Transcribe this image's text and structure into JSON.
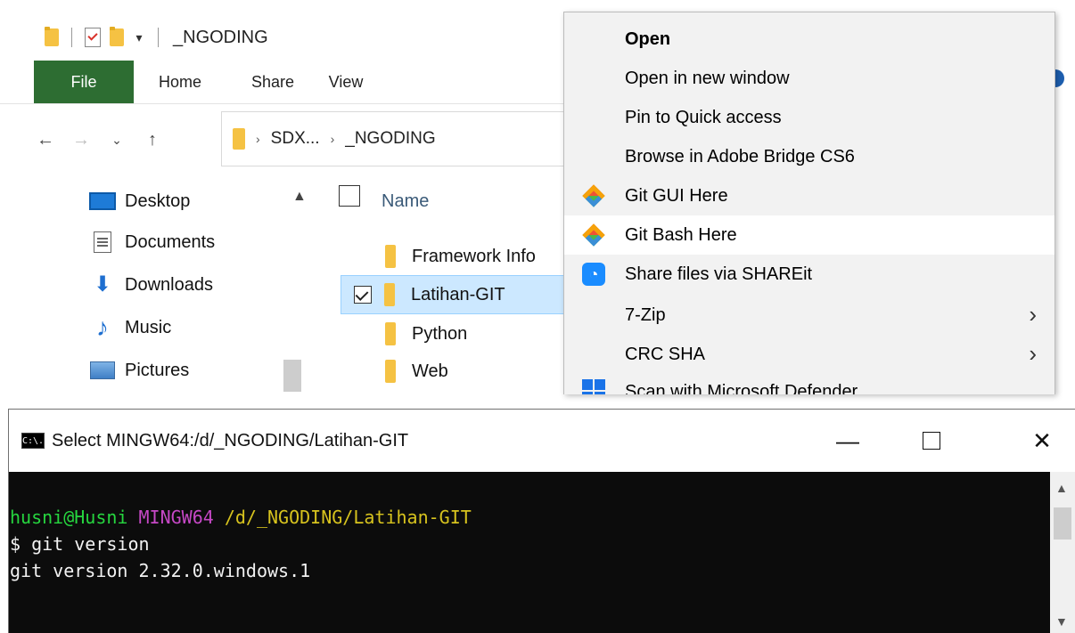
{
  "explorer": {
    "title": "_NGODING",
    "qat_dropdown": "▾",
    "tabs": [
      {
        "label": "File"
      },
      {
        "label": "Home"
      },
      {
        "label": "Share"
      },
      {
        "label": "View"
      }
    ],
    "nav": {
      "back": "←",
      "forward": "→",
      "recent": "⌄",
      "up": "↑"
    },
    "address": {
      "parts": [
        "SDX...",
        "_NGODING"
      ],
      "sep": "›"
    },
    "sidebar": [
      {
        "label": "Desktop",
        "icon": "desktop-icon"
      },
      {
        "label": "Documents",
        "icon": "documents-icon"
      },
      {
        "label": "Downloads",
        "icon": "downloads-icon"
      },
      {
        "label": "Music",
        "icon": "music-icon"
      },
      {
        "label": "Pictures",
        "icon": "pictures-icon"
      }
    ],
    "column_header": "Name",
    "files": [
      {
        "name": "Framework Info",
        "selected": false
      },
      {
        "name": "Latihan-GIT",
        "selected": true
      },
      {
        "name": "Python",
        "selected": false
      },
      {
        "name": "Web",
        "selected": false
      }
    ]
  },
  "context_menu": {
    "items": [
      {
        "label": "Open",
        "bold": true
      },
      {
        "label": "Open in new window"
      },
      {
        "label": "Pin to Quick access"
      },
      {
        "label": "Browse in Adobe Bridge CS6"
      },
      {
        "label": "Git GUI Here",
        "icon": "git-gui-icon"
      },
      {
        "label": "Git Bash Here",
        "icon": "git-bash-icon",
        "hover": true
      },
      {
        "label": "Share files via SHAREit",
        "icon": "shareit-icon"
      },
      {
        "label": "7-Zip",
        "submenu": true
      },
      {
        "label": "CRC SHA",
        "submenu": true
      },
      {
        "label": "Scan with Microsoft Defender",
        "icon": "defender-icon"
      }
    ],
    "submenu_glyph": "›"
  },
  "terminal": {
    "title": "Select MINGW64:/d/_NGODING/Latihan-GIT",
    "icon_text": "C:\\.",
    "minimize": "—",
    "close": "✕",
    "prompt_user": "husni@Husni",
    "prompt_env": "MINGW64",
    "prompt_path": "/d/_NGODING/Latihan-GIT",
    "command": "$ git version",
    "output": "git version 2.32.0.windows.1",
    "scroll_up": "▲",
    "scroll_down": "▼"
  },
  "colors": {
    "file_tab": "#2d6d32",
    "selection": "#cce8ff",
    "menu_bg": "#f2f2f2",
    "prompt_green": "#26d63f",
    "prompt_magenta": "#c648c6",
    "prompt_yellow": "#d7c31e"
  }
}
